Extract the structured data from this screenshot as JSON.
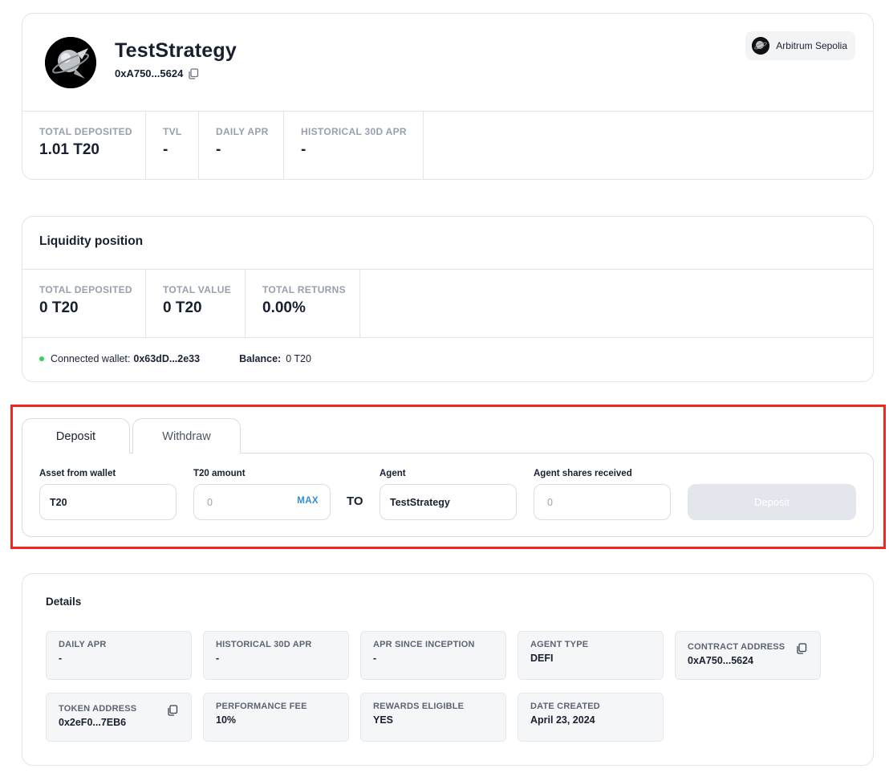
{
  "header": {
    "strategy_name": "TestStrategy",
    "strategy_address": "0xA750...5624",
    "network": "Arbitrum Sepolia",
    "stats": [
      {
        "label": "TOTAL DEPOSITED",
        "value": "1.01 T20"
      },
      {
        "label": "TVL",
        "value": "-"
      },
      {
        "label": "DAILY APR",
        "value": "-"
      },
      {
        "label": "HISTORICAL 30D APR",
        "value": "-"
      }
    ]
  },
  "liquidity": {
    "title": "Liquidity position",
    "stats": [
      {
        "label": "TOTAL DEPOSITED",
        "value": "0 T20"
      },
      {
        "label": "TOTAL VALUE",
        "value": "0 T20"
      },
      {
        "label": "TOTAL RETURNS",
        "value": "0.00%"
      }
    ],
    "wallet_label": "Connected wallet:",
    "wallet_value": "0x63dD...2e33",
    "balance_label": "Balance:",
    "balance_value": "0 T20"
  },
  "deposit_form": {
    "tabs": [
      {
        "label": "Deposit",
        "active": true
      },
      {
        "label": "Withdraw",
        "active": false
      }
    ],
    "asset_label": "Asset from wallet",
    "asset_value": "T20",
    "amount_label": "T20 amount",
    "amount_placeholder": "0",
    "max_label": "MAX",
    "to_label": "TO",
    "agent_label": "Agent",
    "agent_value": "TestStrategy",
    "shares_label": "Agent shares received",
    "shares_placeholder": "0",
    "submit_label": "Deposit"
  },
  "details": {
    "title": "Details",
    "items": [
      {
        "label": "DAILY APR",
        "value": "-"
      },
      {
        "label": "HISTORICAL 30D APR",
        "value": "-"
      },
      {
        "label": "APR SINCE INCEPTION",
        "value": "-"
      },
      {
        "label": "AGENT TYPE",
        "value": "DEFI"
      },
      {
        "label": "CONTRACT ADDRESS",
        "value": "0xA750...5624"
      },
      {
        "label": "TOKEN ADDRESS",
        "value": "0x2eF0...7EB6"
      },
      {
        "label": "PERFORMANCE FEE",
        "value": "10%"
      },
      {
        "label": "REWARDS ELIGIBLE",
        "value": "YES"
      },
      {
        "label": "DATE CREATED",
        "value": "April 23, 2024"
      }
    ]
  },
  "colors": {
    "highlight": "#f2261e",
    "connected_dot": "#2fd35c",
    "max_link": "#2d8fe0",
    "disabled_button": "#e3e6ec"
  },
  "icons": {
    "avatar": "strategy-logo-icon",
    "network": "arbitrum-logo-icon",
    "copy": "copy-icon"
  }
}
